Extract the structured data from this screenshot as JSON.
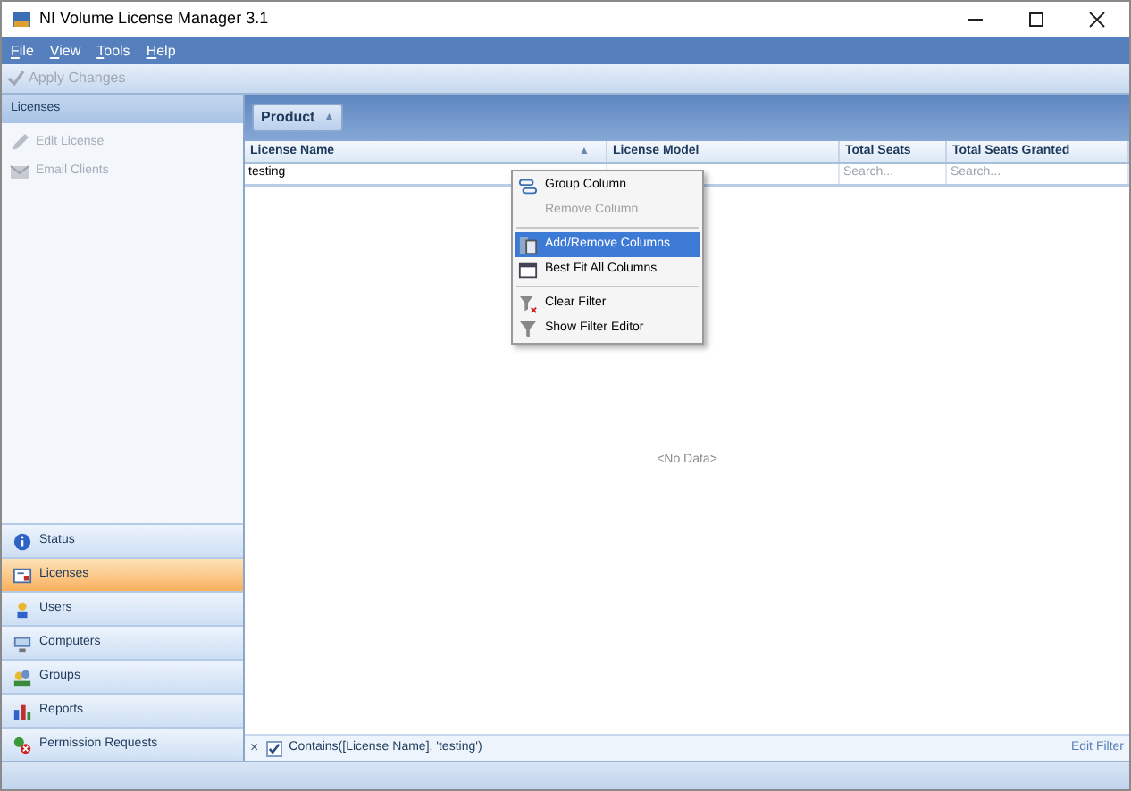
{
  "window": {
    "title": "NI Volume License Manager 3.1"
  },
  "menu": [
    "File",
    "View",
    "Tools",
    "Help"
  ],
  "toolbar": {
    "apply_button": {
      "label": "Apply Changes",
      "disabled": true
    }
  },
  "sidebar": {
    "header": "Licenses",
    "actions": [
      {
        "label": "Edit License",
        "disabled": true
      },
      {
        "label": "Email Clients",
        "disabled": true
      }
    ],
    "nav": [
      {
        "label": "Status",
        "selected": false
      },
      {
        "label": "Licenses",
        "selected": true
      },
      {
        "label": "Users",
        "selected": false
      },
      {
        "label": "Computers",
        "selected": false
      },
      {
        "label": "Groups",
        "selected": false
      },
      {
        "label": "Reports",
        "selected": false
      },
      {
        "label": "Permission Requests",
        "selected": false
      }
    ]
  },
  "grid": {
    "group_chip": "Product",
    "group_chip_sort": "▲",
    "columns": [
      {
        "label": "License Name",
        "sort": "▲"
      },
      {
        "label": "License Model"
      },
      {
        "label": "Total Seats"
      },
      {
        "label": "Total Seats Granted"
      }
    ],
    "filter_row": [
      {
        "kind": "text",
        "value": "testing"
      },
      {
        "kind": "blank"
      },
      {
        "kind": "text",
        "placeholder": "Search..."
      },
      {
        "kind": "text",
        "placeholder": "Search..."
      }
    ],
    "empty_text": "<No Data>",
    "filter_bar": {
      "close": "×",
      "enabled": true,
      "expression": "Contains([License Name], 'testing')",
      "edit_link": "Edit Filter"
    }
  },
  "context_menu": [
    {
      "kind": "item",
      "label": "Group Column",
      "disabled": false,
      "selected": false
    },
    {
      "kind": "item",
      "label": "Remove Column",
      "disabled": true,
      "selected": false
    },
    {
      "kind": "separator"
    },
    {
      "kind": "item",
      "label": "Add/Remove Columns",
      "disabled": false,
      "selected": true
    },
    {
      "kind": "item",
      "label": "Best Fit All Columns",
      "disabled": false,
      "selected": false
    },
    {
      "kind": "separator"
    },
    {
      "kind": "item",
      "label": "Clear Filter",
      "disabled": false,
      "selected": false
    },
    {
      "kind": "item",
      "label": "Show Filter Editor",
      "disabled": false,
      "selected": false
    }
  ]
}
